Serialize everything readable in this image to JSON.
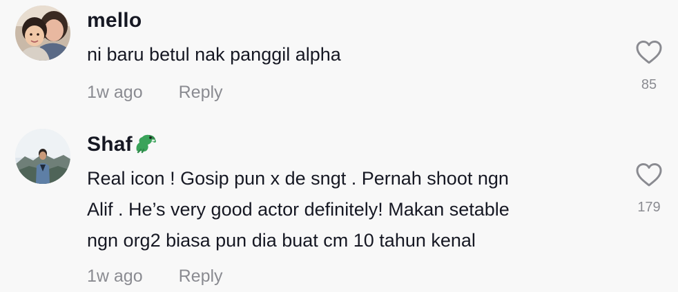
{
  "comments": [
    {
      "username": "mello",
      "text": "ni baru betul nak panggil alpha",
      "time": "1w ago",
      "reply_label": "Reply",
      "likes": "85",
      "avatar": "two-people-photo"
    },
    {
      "username": "Shaf",
      "username_emoji": "crocodile-emoji",
      "text_lines": [
        "Real icon ! Gosip pun x de sngt . Pernah shoot ngn",
        "Alif . He’s very good actor definitely! Makan setable",
        "ngn org2 biasa pun dia buat cm 10 tahun kenal"
      ],
      "time": "1w ago",
      "reply_label": "Reply",
      "likes": "179",
      "avatar": "person-mountain-photo"
    }
  ],
  "colors": {
    "background": "#f8f8f8",
    "primary_text": "#161823",
    "secondary_text": "#8a8b91",
    "icon": "#8a8b91",
    "emoji": "#3aa35a"
  }
}
